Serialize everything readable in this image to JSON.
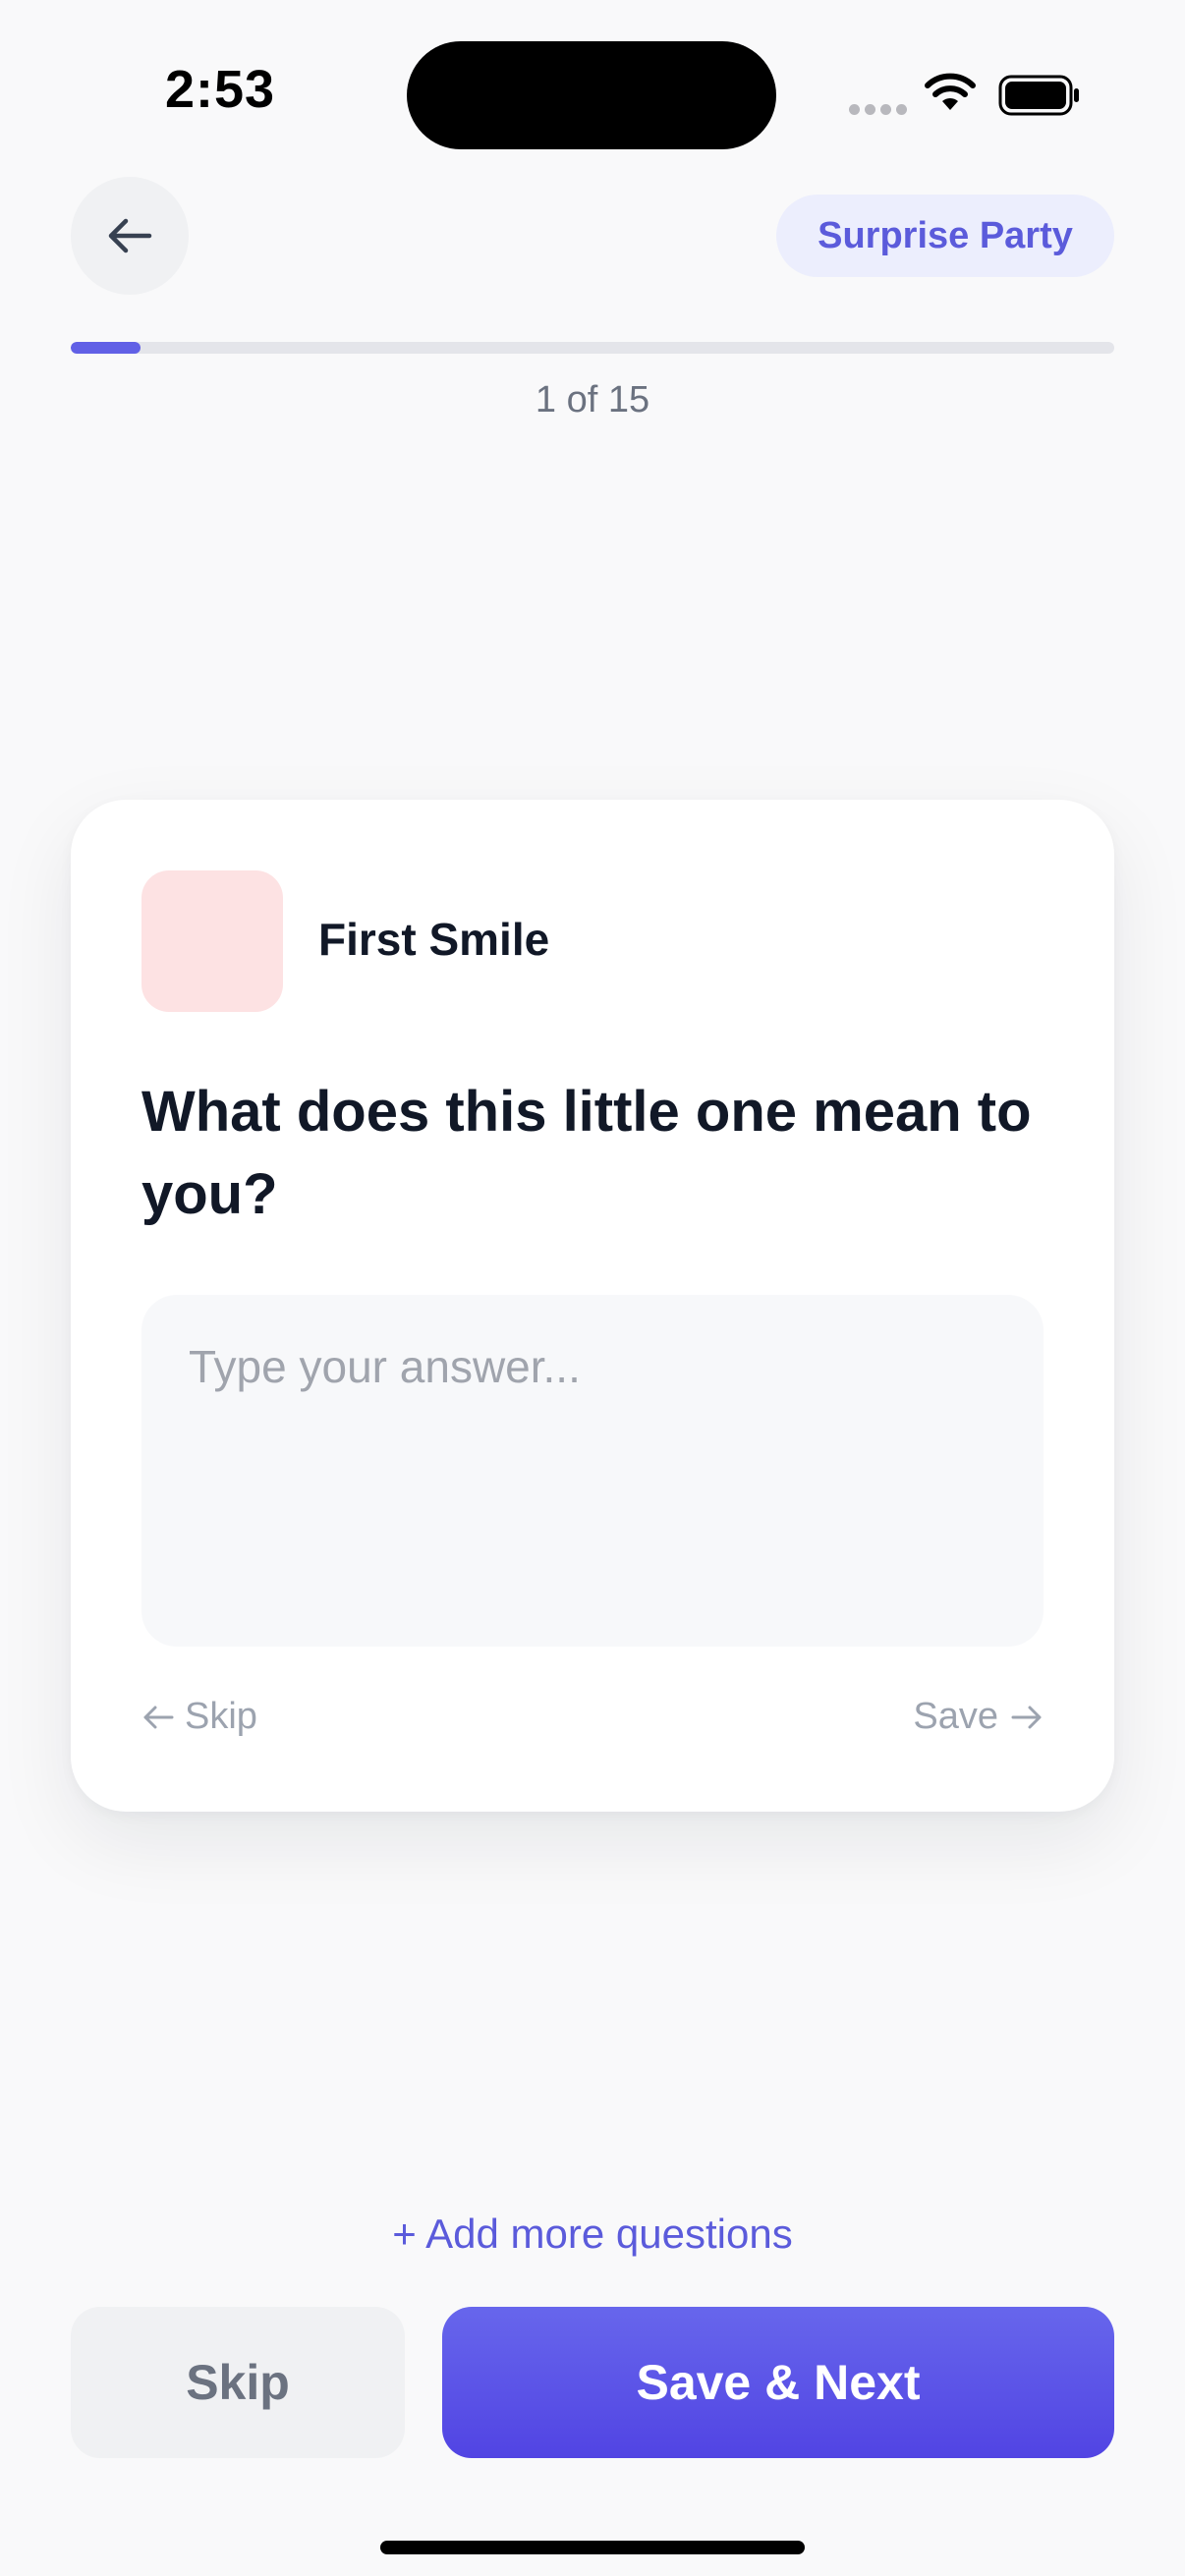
{
  "status_bar": {
    "time": "2:53"
  },
  "header": {
    "back_icon": "arrow-left-icon",
    "tag": "Surprise Party"
  },
  "progress": {
    "current": 1,
    "total": 15,
    "label": "1 of 15",
    "fraction": 0.0667,
    "color": "#6160e6"
  },
  "card": {
    "thumbnail_color": "#fde2e3",
    "title": "First Smile",
    "question": "What does this little one mean to you?",
    "answer_value": "",
    "answer_placeholder": "Type your answer...",
    "skip_label": "Skip",
    "save_label": "Save"
  },
  "footer": {
    "add_more_label": "+ Add more questions",
    "skip_button": "Skip",
    "save_next_button": "Save & Next"
  },
  "colors": {
    "accent": "#5b5bdb",
    "background": "#f9f9fa"
  }
}
